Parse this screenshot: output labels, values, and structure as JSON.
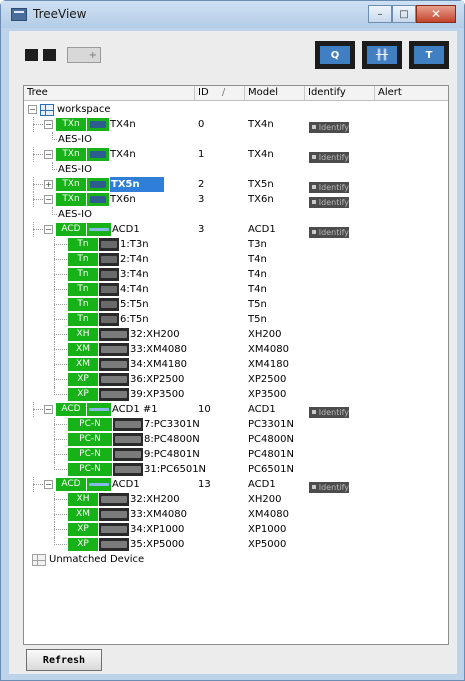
{
  "window": {
    "title": "TreeView",
    "minimize_glyph": "–",
    "maximize_glyph": "□",
    "close_glyph": "✕"
  },
  "toolbar": {
    "left_icons": [
      "expand-all-icon",
      "collapse-all-icon",
      "add-device-icon"
    ],
    "right_buttons": [
      "search-device-icon",
      "meter-icon",
      "tools-icon"
    ],
    "add_glyph": "+",
    "right_glyphs": [
      "Q",
      "╫╫",
      "T"
    ]
  },
  "columns": {
    "tree": "Tree",
    "id": "ID",
    "id_sort_glyph": "/",
    "model": "Model",
    "identify": "Identify",
    "alert": "Alert"
  },
  "identify_label": "Identify",
  "tree": {
    "root_label": "workspace",
    "unmatched_label": "Unmatched Device",
    "expander_minus": "−",
    "expander_plus": "+",
    "rows": [
      {
        "kind": "root"
      },
      {
        "kind": "device",
        "depth": 1,
        "badge": "TXn",
        "dev": "tx",
        "label": "TX4n",
        "id": "0",
        "model": "TX4n",
        "identify": true,
        "expander": "minus"
      },
      {
        "kind": "leaf",
        "depth": 2,
        "label": "AES-IO"
      },
      {
        "kind": "device",
        "depth": 1,
        "badge": "TXn",
        "dev": "tx",
        "label": "TX4n",
        "id": "1",
        "model": "TX4n",
        "identify": true,
        "expander": "minus"
      },
      {
        "kind": "leaf",
        "depth": 2,
        "label": "AES-IO"
      },
      {
        "kind": "device",
        "depth": 1,
        "badge": "TXn",
        "dev": "tx",
        "label": "TX5n",
        "id": "2",
        "model": "TX5n",
        "identify": true,
        "expander": "plus",
        "selected": true
      },
      {
        "kind": "device",
        "depth": 1,
        "badge": "TXn",
        "dev": "tx",
        "label": "TX6n",
        "id": "3",
        "model": "TX6n",
        "identify": true,
        "expander": "minus"
      },
      {
        "kind": "leaf",
        "depth": 2,
        "label": "AES-IO"
      },
      {
        "kind": "device",
        "depth": 1,
        "badge": "ACD",
        "dev": "acd",
        "label": "ACD1",
        "id": "3",
        "model": "ACD1",
        "identify": true,
        "expander": "minus"
      },
      {
        "kind": "amp",
        "depth": 2,
        "badge": "Tn",
        "dev": "amp",
        "label": "1:T3n",
        "model": "T3n"
      },
      {
        "kind": "amp",
        "depth": 2,
        "badge": "Tn",
        "dev": "amp",
        "label": "2:T4n",
        "model": "T4n"
      },
      {
        "kind": "amp",
        "depth": 2,
        "badge": "Tn",
        "dev": "amp",
        "label": "3:T4n",
        "model": "T4n"
      },
      {
        "kind": "amp",
        "depth": 2,
        "badge": "Tn",
        "dev": "amp",
        "label": "4:T4n",
        "model": "T4n"
      },
      {
        "kind": "amp",
        "depth": 2,
        "badge": "Tn",
        "dev": "amp",
        "label": "5:T5n",
        "model": "T5n"
      },
      {
        "kind": "amp",
        "depth": 2,
        "badge": "Tn",
        "dev": "amp",
        "label": "6:T5n",
        "model": "T5n"
      },
      {
        "kind": "amp",
        "depth": 2,
        "badge": "XH",
        "dev": "wamp",
        "label": "32:XH200",
        "model": "XH200"
      },
      {
        "kind": "amp",
        "depth": 2,
        "badge": "XM",
        "dev": "wamp",
        "label": "33:XM4080",
        "model": "XM4080"
      },
      {
        "kind": "amp",
        "depth": 2,
        "badge": "XM",
        "dev": "wamp",
        "label": "34:XM4180",
        "model": "XM4180"
      },
      {
        "kind": "amp",
        "depth": 2,
        "badge": "XP",
        "dev": "wamp",
        "label": "36:XP2500",
        "model": "XP2500"
      },
      {
        "kind": "amp",
        "depth": 2,
        "badge": "XP",
        "dev": "wamp",
        "label": "39:XP3500",
        "model": "XP3500",
        "last": true
      },
      {
        "kind": "device",
        "depth": 1,
        "badge": "ACD",
        "dev": "acd",
        "label": "ACD1 #1",
        "id": "10",
        "model": "ACD1",
        "identify": true,
        "expander": "minus"
      },
      {
        "kind": "amp",
        "depth": 2,
        "badge": "PC-N",
        "badge_wide": true,
        "dev": "wamp",
        "label": "7:PC3301N",
        "model": "PC3301N"
      },
      {
        "kind": "amp",
        "depth": 2,
        "badge": "PC-N",
        "badge_wide": true,
        "dev": "wamp",
        "label": "8:PC4800N",
        "model": "PC4800N"
      },
      {
        "kind": "amp",
        "depth": 2,
        "badge": "PC-N",
        "badge_wide": true,
        "dev": "wamp",
        "label": "9:PC4801N",
        "model": "PC4801N"
      },
      {
        "kind": "amp",
        "depth": 2,
        "badge": "PC-N",
        "badge_wide": true,
        "dev": "wamp",
        "label": "31:PC6501N",
        "model": "PC6501N",
        "last": true
      },
      {
        "kind": "device",
        "depth": 1,
        "badge": "ACD",
        "dev": "acd",
        "label": "ACD1",
        "id": "13",
        "model": "ACD1",
        "identify": true,
        "expander": "minus"
      },
      {
        "kind": "amp",
        "depth": 2,
        "badge": "XH",
        "dev": "wamp",
        "label": "32:XH200",
        "model": "XH200"
      },
      {
        "kind": "amp",
        "depth": 2,
        "badge": "XM",
        "dev": "wamp",
        "label": "33:XM4080",
        "model": "XM4080"
      },
      {
        "kind": "amp",
        "depth": 2,
        "badge": "XP",
        "dev": "wamp",
        "label": "34:XP1000",
        "model": "XP1000"
      },
      {
        "kind": "amp",
        "depth": 2,
        "badge": "XP",
        "dev": "wamp",
        "label": "35:XP5000",
        "model": "XP5000",
        "last": true
      },
      {
        "kind": "unmatched"
      }
    ]
  },
  "refresh_label": "Refresh",
  "colors": {
    "badge_green": "#17b217",
    "selection_blue": "#2f7fd8",
    "toolbar_button_blue": "#3f7fc2",
    "identify_gray": "#4c4c4c"
  }
}
